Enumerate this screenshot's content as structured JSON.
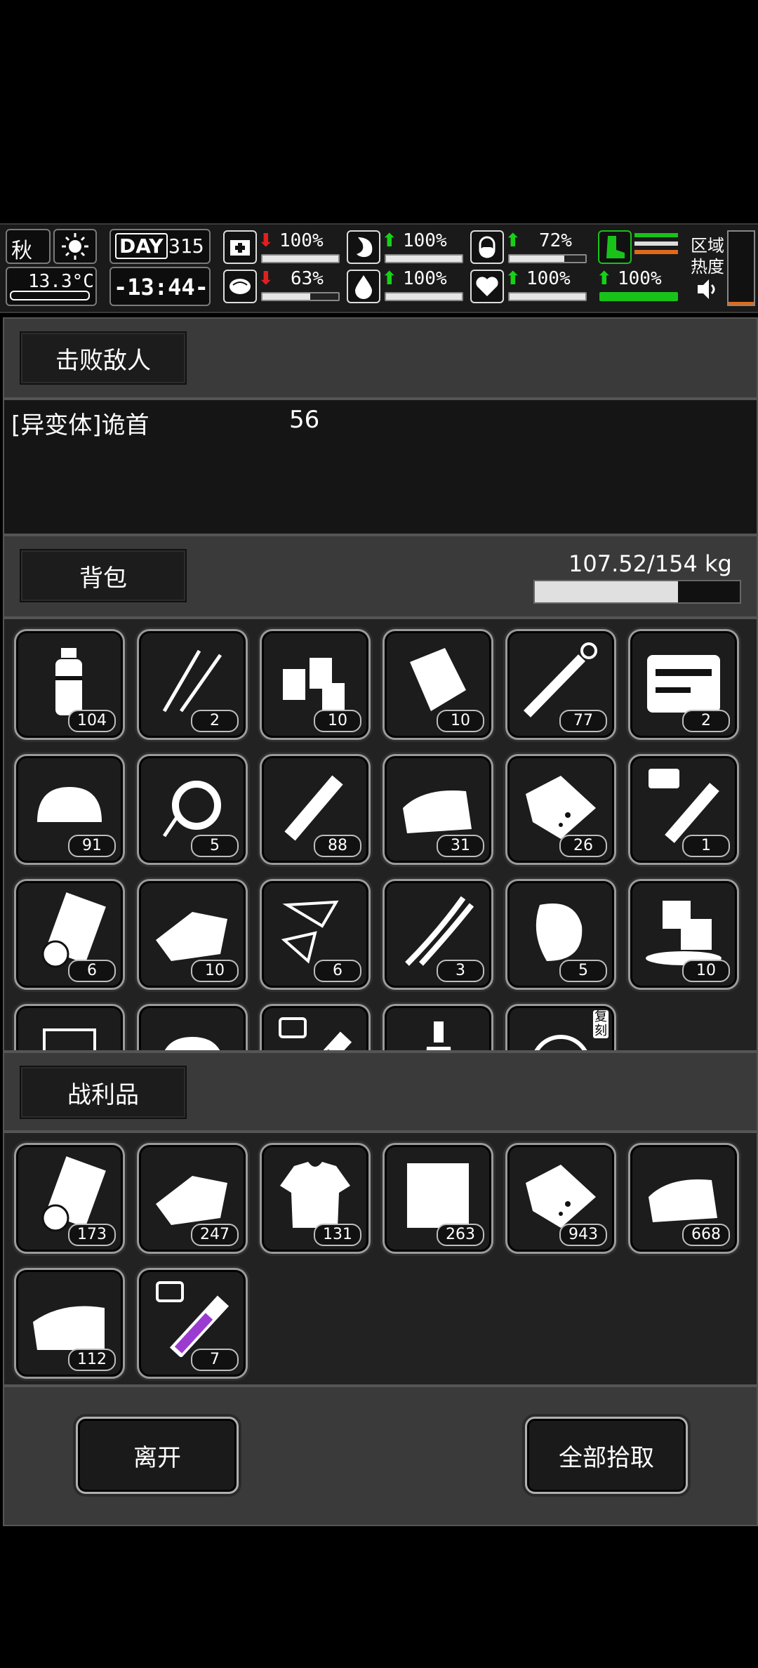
{
  "hud": {
    "season": "秋",
    "temperature": "13.3°C",
    "day_label": "DAY",
    "day_number": "315",
    "time": "-13:44-",
    "stats": [
      {
        "name": "health",
        "trend": "down",
        "value": "100%",
        "level": 1.0
      },
      {
        "name": "hunger",
        "trend": "up",
        "value": "100%",
        "level": 1.0
      },
      {
        "name": "pill",
        "trend": "up",
        "value": "72%",
        "level": 0.72
      },
      {
        "name": "brain",
        "trend": "down",
        "value": "63%",
        "level": 0.63
      },
      {
        "name": "water",
        "trend": "up",
        "value": "100%",
        "level": 1.0
      },
      {
        "name": "heart",
        "trend": "up",
        "value": "100%",
        "level": 1.0
      },
      {
        "name": "stamina",
        "trend": "up",
        "value": "100%",
        "level": 1.0
      }
    ],
    "zone_heat_line1": "区域",
    "zone_heat_line2": "热度"
  },
  "defeated": {
    "tab_label": "击败敌人",
    "enemy_name": "[异变体]诡首",
    "enemy_count": "56"
  },
  "backpack": {
    "tab_label": "背包",
    "weight": "107.52/154 kg",
    "weight_fraction": 0.698,
    "items": [
      {
        "icon": "water-bottle",
        "count": "104"
      },
      {
        "icon": "lockpick",
        "count": "2"
      },
      {
        "icon": "pill-bottles",
        "count": "10"
      },
      {
        "icon": "bandage-roll",
        "count": "10"
      },
      {
        "icon": "syringe",
        "count": "77"
      },
      {
        "icon": "toolbox",
        "count": "2"
      },
      {
        "icon": "bread",
        "count": "91"
      },
      {
        "icon": "rope",
        "count": "5"
      },
      {
        "icon": "injector",
        "count": "88"
      },
      {
        "icon": "cloth",
        "count": "31"
      },
      {
        "icon": "meat",
        "count": "26"
      },
      {
        "icon": "iv-test-tube",
        "count": "1"
      },
      {
        "icon": "paper-roll",
        "count": "6"
      },
      {
        "icon": "cloth-sheets",
        "count": "10"
      },
      {
        "icon": "glass-shards",
        "count": "6"
      },
      {
        "icon": "wires",
        "count": "3"
      },
      {
        "icon": "steak",
        "count": "5"
      },
      {
        "icon": "ice-cubes",
        "count": "10"
      },
      {
        "icon": "beaker",
        "count": ""
      },
      {
        "icon": "bread",
        "count": ""
      },
      {
        "icon": "test-tube",
        "count": ""
      },
      {
        "icon": "bottle",
        "count": ""
      },
      {
        "icon": "copy-item",
        "count": "",
        "badge": "复刻"
      }
    ]
  },
  "loot": {
    "tab_label": "战利品",
    "items": [
      {
        "icon": "paper-roll",
        "count": "173"
      },
      {
        "icon": "cloth-sheets",
        "count": "247"
      },
      {
        "icon": "torn-shirt",
        "count": "131"
      },
      {
        "icon": "fabric",
        "count": "263"
      },
      {
        "icon": "meat",
        "count": "943"
      },
      {
        "icon": "cloth",
        "count": "668"
      },
      {
        "icon": "towel",
        "count": "112"
      },
      {
        "icon": "test-tube",
        "count": "7"
      }
    ]
  },
  "actions": {
    "leave_label": "离开",
    "take_all_label": "全部拾取"
  }
}
